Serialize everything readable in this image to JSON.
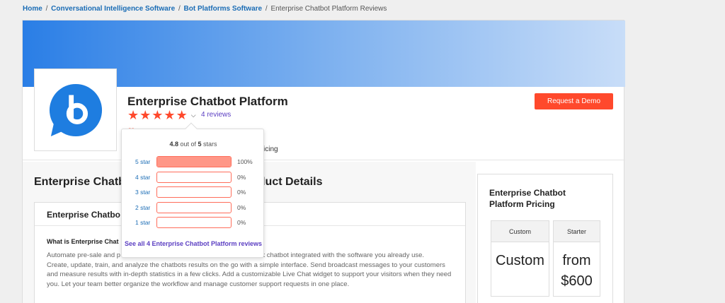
{
  "breadcrumb": {
    "items": [
      "Home",
      "Conversational Intelligence Software",
      "Bot Platforms Software"
    ],
    "current": "Enterprise Chatbot Platform Reviews",
    "separator": "/"
  },
  "product": {
    "name": "Enterprise Chatbot Platform",
    "reviews_link": "4 reviews",
    "star_glyph": "★",
    "pricing_tab_fragment": "icing"
  },
  "demo_button": "Request a Demo",
  "popup": {
    "rating": "4.8",
    "summary_mid": "out of",
    "max": "5",
    "summary_end": "stars",
    "rows": [
      {
        "label": "5 star",
        "pct": "100%",
        "fill": 1.0
      },
      {
        "label": "4 star",
        "pct": "0%",
        "fill": 0
      },
      {
        "label": "3 star",
        "pct": "0%",
        "fill": 0
      },
      {
        "label": "2 star",
        "pct": "0%",
        "fill": 0
      },
      {
        "label": "1 star",
        "pct": "0%",
        "fill": 0
      }
    ],
    "link": "See all 4 Enterprise Chatbot Platform reviews"
  },
  "details": {
    "heading_start": "Enterprise Chatb",
    "heading_end": "oduct Details",
    "inner_title": "Enterprise Chatbo",
    "what_is": "What is Enterprise Chat",
    "desc_line1": "Automate pre-sale and p",
    "desc_line1_end": "art chatbot integrated with the software you already use.",
    "desc_rest": "Create, update, train, and analyze the chatbots results on the go with a simple interface. Send broadcast messages to your customers and measure results with in-depth statistics in a few clicks. Add a customizable Live Chat widget to support your visitors when they need you. Let your team better organize the workflow and manage customer support requests in one place."
  },
  "pricing": {
    "title": "Enterprise Chatbot Platform Pricing",
    "plans": [
      {
        "name": "Custom",
        "price": "Custom"
      },
      {
        "name": "Starter",
        "price": "from $600"
      }
    ]
  },
  "colors": {
    "accent": "#ff492c",
    "link": "#1a6cb5",
    "purple_link": "#5b3ec2",
    "logo_blue": "#1e7de0"
  }
}
